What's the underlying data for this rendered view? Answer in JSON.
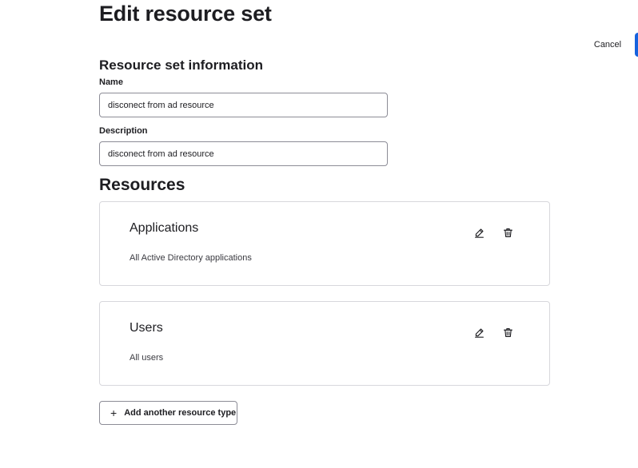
{
  "header": {
    "title": "Edit resource set",
    "cancel_label": "Cancel",
    "primary_color": "#1662dd"
  },
  "info": {
    "section_title": "Resource set information",
    "name_label": "Name",
    "name_value": "disconect from ad resource",
    "description_label": "Description",
    "description_value": "disconect from ad resource"
  },
  "resources": {
    "heading": "Resources",
    "items": [
      {
        "title": "Applications",
        "description": "All Active Directory applications",
        "edit_icon": "pencil-icon",
        "delete_icon": "trash-icon"
      },
      {
        "title": "Users",
        "description": "All users",
        "edit_icon": "pencil-icon",
        "delete_icon": "trash-icon"
      }
    ],
    "add_label": "Add another resource type",
    "add_icon": "plus-icon"
  }
}
